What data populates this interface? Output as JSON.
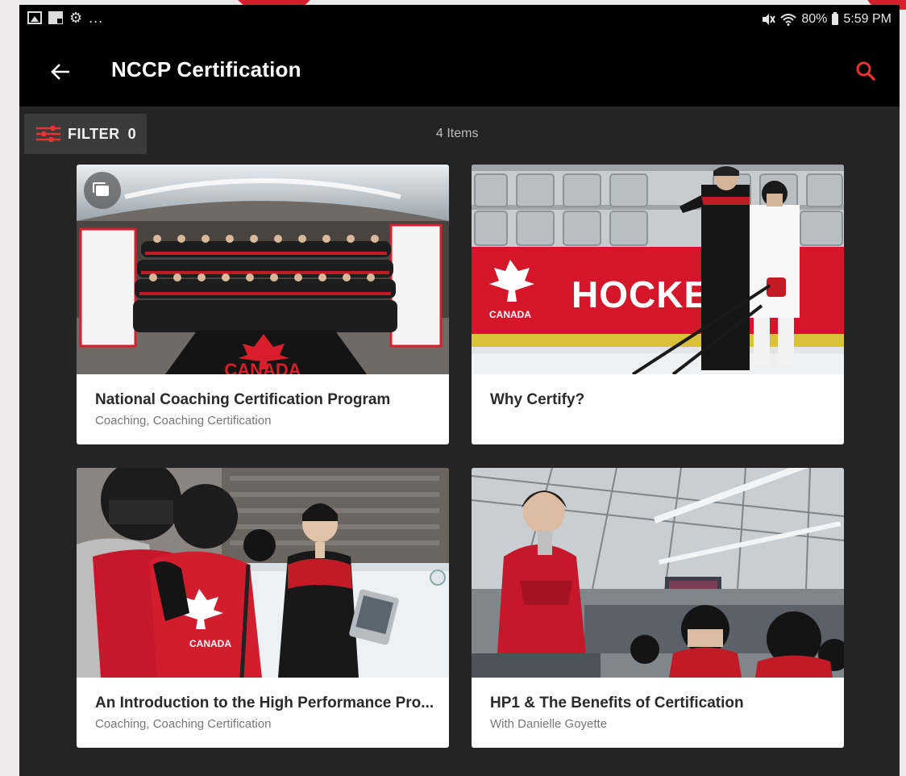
{
  "statusbar": {
    "left_icons": [
      "gallery-notification-icon",
      "flipboard-notification-icon",
      "settings-notification-icon"
    ],
    "more_indicator": "...",
    "battery": "80%",
    "time": "5:59 PM",
    "right_icons": [
      "mute-icon",
      "wifi-icon",
      "battery-icon"
    ]
  },
  "appbar": {
    "title": "NCCP Certification",
    "back_icon": "arrow-left-icon",
    "search_icon": "search-icon",
    "accent_color": "#e8332f"
  },
  "filter": {
    "label": "FILTER",
    "count": "0",
    "icon": "filter-sliders-icon"
  },
  "items_count": "4 Items",
  "cards": [
    {
      "title": "National Coaching Certification Program",
      "subtitle": "Coaching, Coaching Certification",
      "badge_icon": "gallery-icon"
    },
    {
      "title": "Why Certify?",
      "subtitle": ""
    },
    {
      "title": "An Introduction to the High Performance Pro...",
      "subtitle": "Coaching, Coaching Certification"
    },
    {
      "title": "HP1 & The Benefits of Certification",
      "subtitle": "With Danielle Goyette"
    }
  ],
  "image_text": {
    "banner": "HOCKEYCA",
    "canada": "CANADA"
  },
  "colors": {
    "background": "#242424",
    "toolbar": "#000000",
    "brand_red": "#d81e2a",
    "card": "#ffffff"
  }
}
